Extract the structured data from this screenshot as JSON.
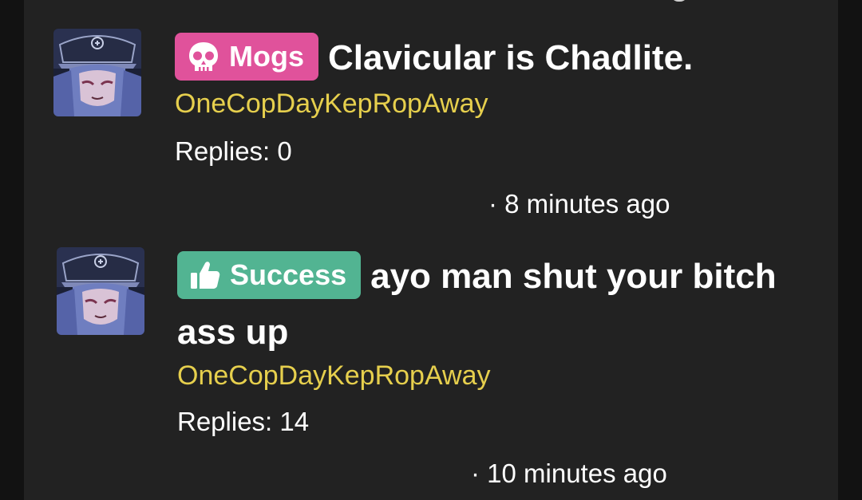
{
  "posts": [
    {
      "badge": {
        "label": "Mogs",
        "icon": "skull-icon",
        "color": "#e0529b"
      },
      "title": "Clavicular is Chadlite.",
      "author": "OneCopDayKepRopAway",
      "replies": "Replies: 0",
      "time": "· 8 minutes ago"
    },
    {
      "badge": {
        "label": "Success",
        "icon": "thumbs-up-icon",
        "color": "#52b492"
      },
      "title_line1": "ayo man shut your bitch",
      "title_line2": "ass up",
      "author": "OneCopDayKepRopAway",
      "replies": "Replies: 14",
      "time": "· 10 minutes ago"
    }
  ],
  "colors": {
    "background": "#222222",
    "author": "#e6cf4d",
    "text": "#ffffff"
  }
}
